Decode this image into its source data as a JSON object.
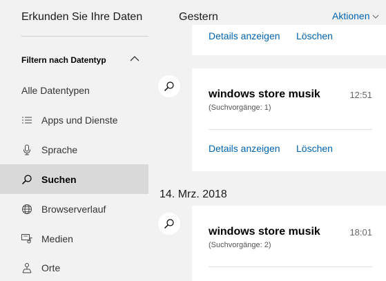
{
  "sidebar": {
    "title": "Erkunden Sie Ihre Daten",
    "filter_heading": "Filtern nach Datentyp",
    "items": [
      {
        "label": "Alle Datentypen",
        "icon": "none",
        "selected": false
      },
      {
        "label": "Apps und Dienste",
        "icon": "list-icon",
        "selected": false
      },
      {
        "label": "Sprache",
        "icon": "microphone-icon",
        "selected": false
      },
      {
        "label": "Suchen",
        "icon": "search-icon",
        "selected": true
      },
      {
        "label": "Browserverlauf",
        "icon": "globe-icon",
        "selected": false
      },
      {
        "label": "Medien",
        "icon": "media-icon",
        "selected": false
      },
      {
        "label": "Orte",
        "icon": "location-icon",
        "selected": false
      }
    ]
  },
  "header": {
    "date_label": "Gestern",
    "actions_label": "Aktionen"
  },
  "groups": [
    {
      "cards": [
        {
          "details_label": "Details anzeigen",
          "delete_label": "Löschen"
        },
        {
          "title": "windows store musik",
          "time": "12:51",
          "subtitle": "(Suchvorgänge: 1)",
          "details_label": "Details anzeigen",
          "delete_label": "Löschen"
        }
      ]
    },
    {
      "date_label": "14. Mrz. 2018",
      "cards": [
        {
          "title": "windows store musik",
          "time": "18:01",
          "subtitle": "(Suchvorgänge: 2)"
        }
      ]
    }
  ],
  "colors": {
    "accent": "#0063b1",
    "selected_bg": "#d9d9d9",
    "background": "#f2f2f2",
    "card": "#ffffff"
  }
}
